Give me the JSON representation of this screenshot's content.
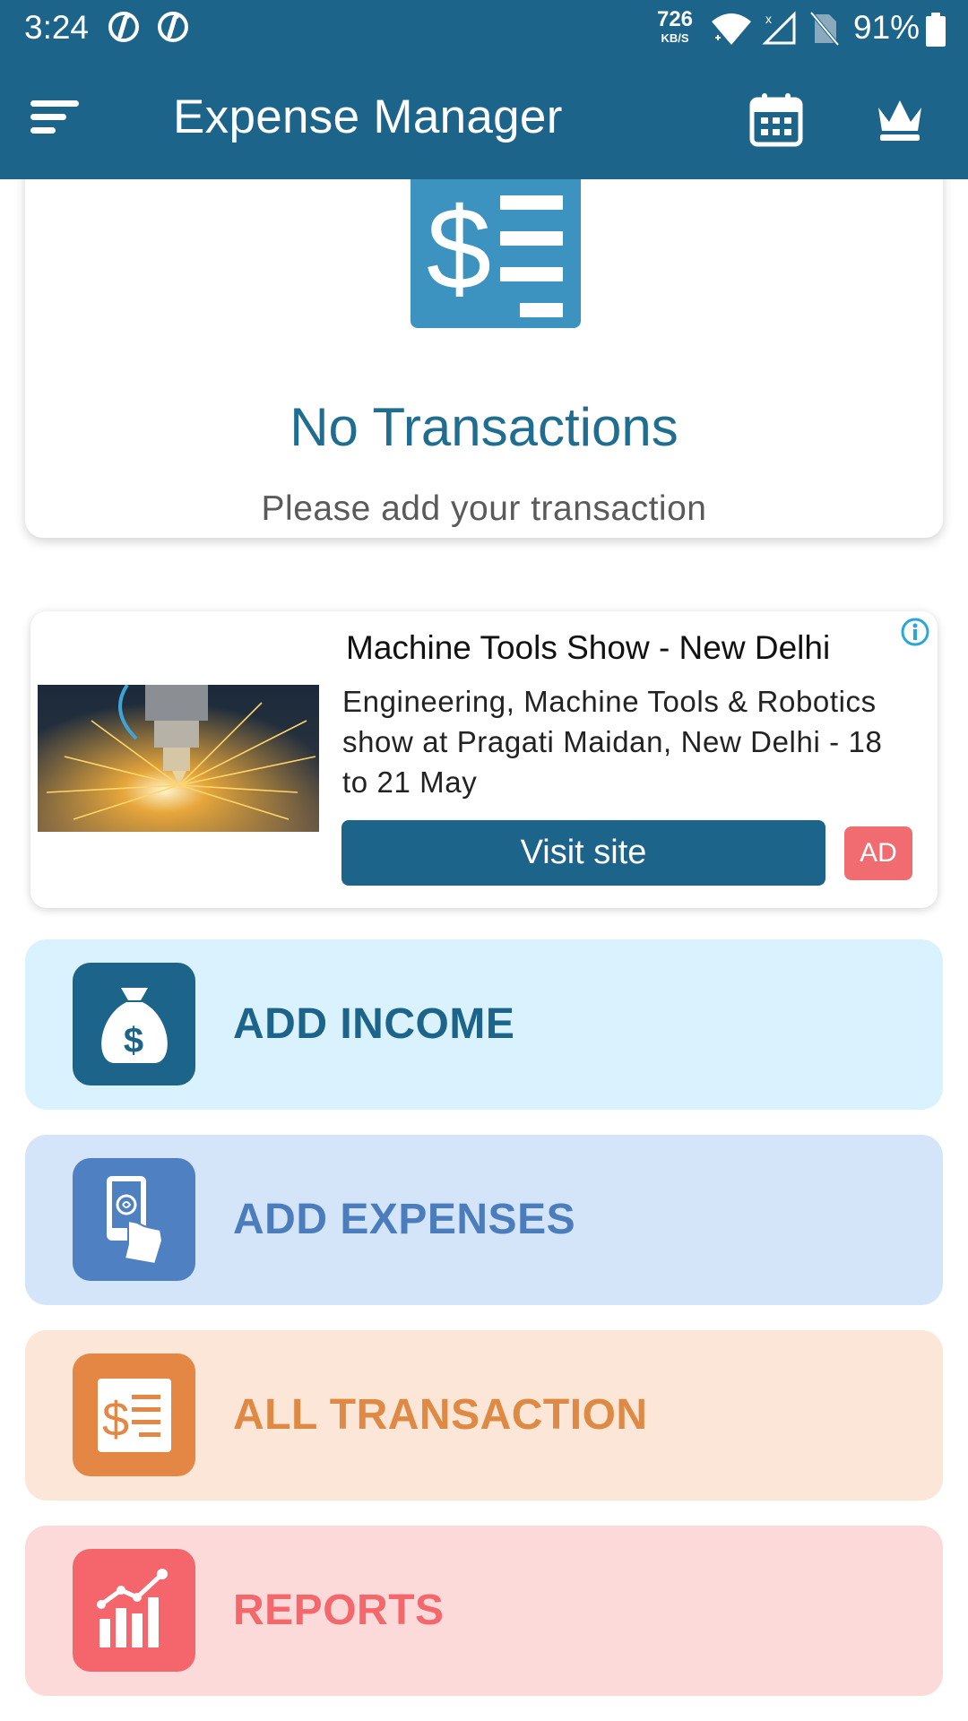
{
  "status_bar": {
    "time": "3:24",
    "net_speed": "726",
    "net_unit": "KB/S",
    "battery": "91%",
    "icons": [
      "info-app-icon",
      "info-app-icon",
      "wifi-icon",
      "signal-icon",
      "no-sim-icon",
      "battery-icon"
    ]
  },
  "app_bar": {
    "title": "Expense Manager",
    "icons": [
      "menu-icon",
      "calendar-icon",
      "crown-icon"
    ]
  },
  "empty_state": {
    "title": "No Transactions",
    "subtitle": "Please add your transaction",
    "icon": "transaction-list-icon"
  },
  "ad": {
    "title": "Machine Tools Show - New Delhi",
    "body": "Engineering, Machine Tools & Robotics show at Pragati Maidan, New Delhi - 18 to 21 May",
    "cta": "Visit site",
    "badge": "AD",
    "image": "laser-cutting-sparks-photo",
    "info_icon": "info-icon"
  },
  "actions": [
    {
      "label": "ADD INCOME",
      "icon": "money-bag-icon",
      "color": "#1c6489"
    },
    {
      "label": "ADD EXPENSES",
      "icon": "hand-bill-icon",
      "color": "#4f80c1"
    },
    {
      "label": "ALL TRANSACTION",
      "icon": "dollar-list-icon",
      "color": "#e58744"
    },
    {
      "label": "REPORTS",
      "icon": "bar-chart-icon",
      "color": "#f4666c"
    }
  ],
  "colors": {
    "primary": "#1c6489",
    "ad_badge": "#f06c70"
  }
}
